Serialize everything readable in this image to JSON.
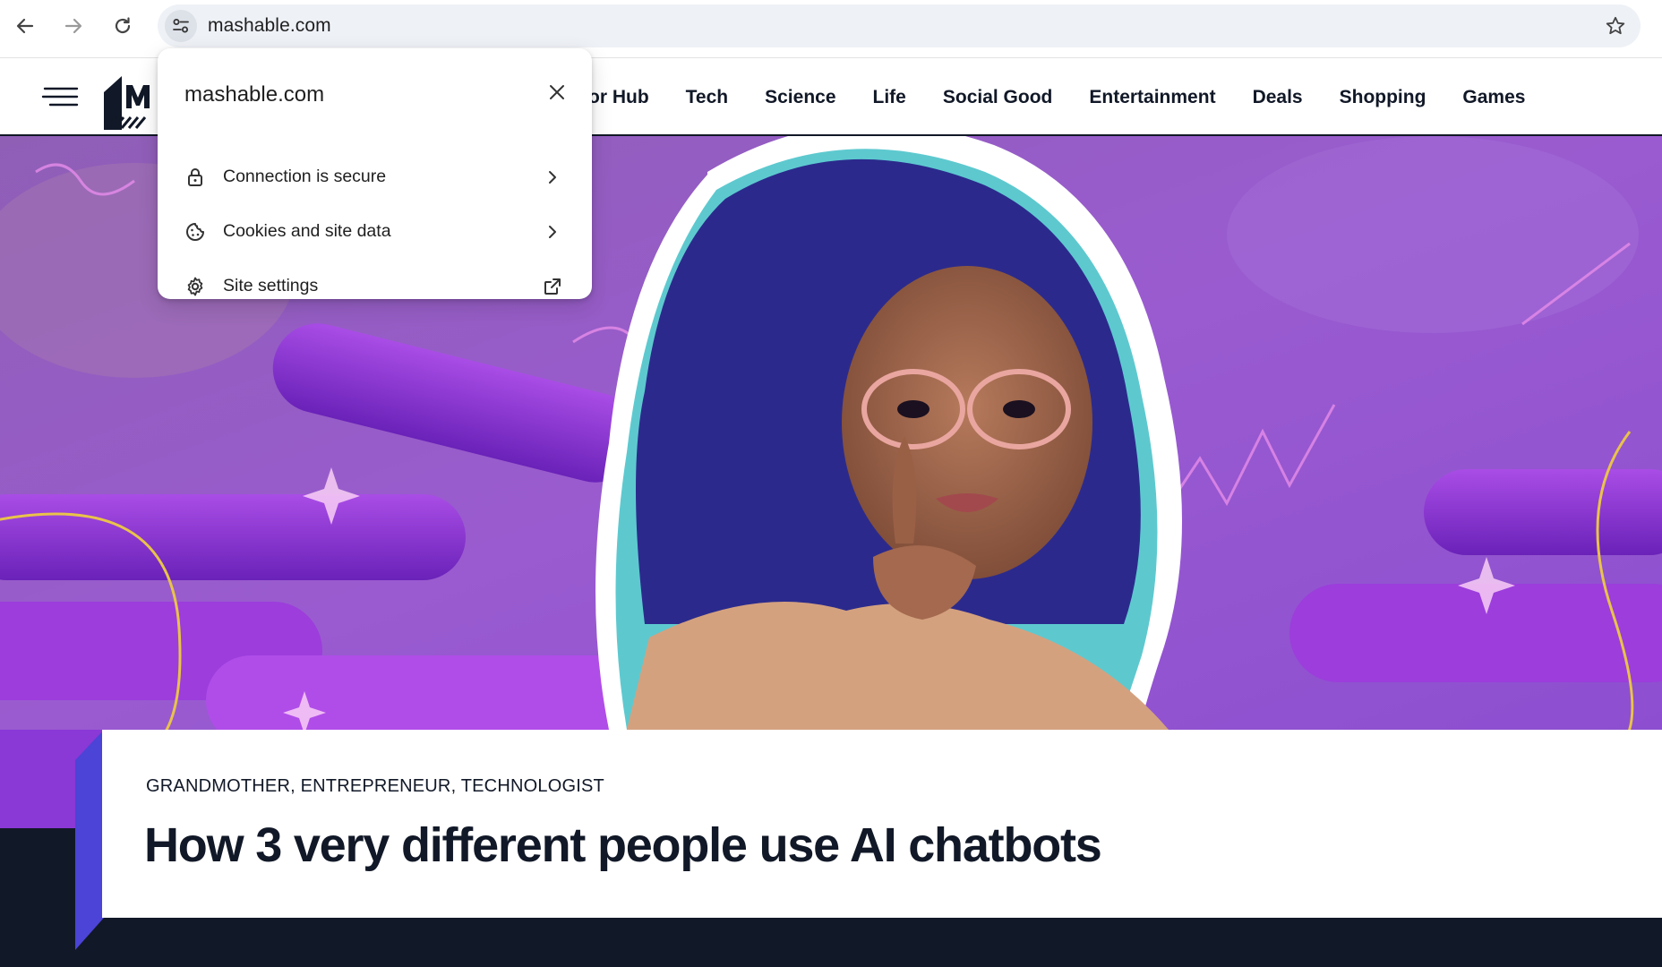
{
  "browser": {
    "url": "mashable.com",
    "back_icon": "arrow-left-icon",
    "forward_icon": "arrow-right-icon",
    "reload_icon": "reload-icon",
    "site_info_icon": "tune-icon",
    "bookmark_icon": "star-icon"
  },
  "site_info_popup": {
    "title": "mashable.com",
    "items": [
      {
        "label": "Connection is secure",
        "icon": "lock-icon",
        "trailing_icon": "chevron-right-icon"
      },
      {
        "label": "Cookies and site data",
        "icon": "cookie-icon",
        "trailing_icon": "chevron-right-icon"
      },
      {
        "label": "Site settings",
        "icon": "gear-icon",
        "trailing_icon": "open-in-new-icon"
      }
    ]
  },
  "header": {
    "menu_icon": "hamburger-menu-icon",
    "nav": [
      "tor Hub",
      "Tech",
      "Science",
      "Life",
      "Social Good",
      "Entertainment",
      "Deals",
      "Shopping",
      "Games"
    ]
  },
  "article": {
    "kicker": "GRANDMOTHER, ENTREPRENEUR, TECHNOLOGIST",
    "headline": "How 3 very different people use AI chatbots"
  },
  "colors": {
    "hero_purple": "#8a4fc8",
    "brand_dark": "#111827",
    "accent_blue": "#4b44d6",
    "popup_bg": "#ffffff"
  }
}
